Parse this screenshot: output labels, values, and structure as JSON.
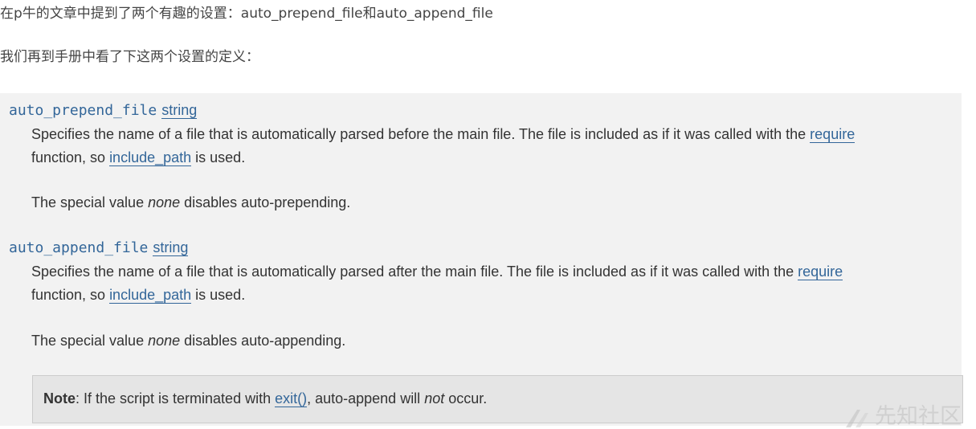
{
  "intro": {
    "line1": "在p牛的文章中提到了两个有趣的设置：auto_prepend_file和auto_append_file",
    "line2": "我们再到手册中看了下这两个设置的定义："
  },
  "entries": [
    {
      "name": "auto_prepend_file",
      "type": "string",
      "desc_before_link": "Specifies the name of a file that is automatically parsed before the main file. The file is included as if it was called with the ",
      "require_link": "require",
      "desc_line2_prefix": "function, so ",
      "include_path_link": "include_path",
      "desc_line2_suffix": " is used.",
      "special_prefix": "The special value ",
      "special_value": "none",
      "special_suffix": " disables auto-prepending."
    },
    {
      "name": "auto_append_file",
      "type": "string",
      "desc_before_link": "Specifies the name of a file that is automatically parsed after the main file. The file is included as if it was called with the ",
      "require_link": "require",
      "desc_line2_prefix": "function, so ",
      "include_path_link": "include_path",
      "desc_line2_suffix": " is used.",
      "special_prefix": "The special value ",
      "special_value": "none",
      "special_suffix": " disables auto-appending."
    }
  ],
  "note": {
    "label": "Note",
    "text_before_link": ": If the script is terminated with ",
    "link": "exit()",
    "text_middle": ", auto-append will ",
    "emphasis": "not",
    "text_after": " occur."
  },
  "watermark": {
    "text": "先知社区",
    "icon": "xianzhi-logo-icon"
  }
}
